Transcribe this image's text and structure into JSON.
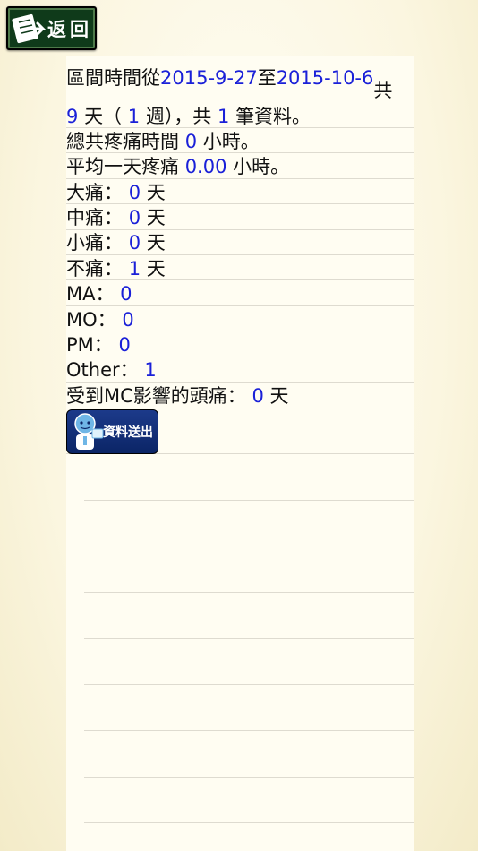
{
  "header": {
    "back_label": "返回"
  },
  "summary": {
    "range_prefix": "區間時間從",
    "start_date": "2015-9-27",
    "to": "至",
    "end_date": "2015-10-6",
    "gong": "共",
    "days": "9",
    "days_suffix": "天（",
    "weeks": "1",
    "weeks_suffix": "週），共",
    "records": "1",
    "records_suffix": "筆資料。",
    "total_label": "總共疼痛時間",
    "total_value": "0",
    "total_unit": "小時。",
    "avg_label": "平均一天疼痛",
    "avg_value": "0.00",
    "avg_unit": "小時。"
  },
  "stats": [
    {
      "label": "大痛：",
      "value": "0",
      "unit": "天"
    },
    {
      "label": "中痛：",
      "value": "0",
      "unit": "天"
    },
    {
      "label": "小痛：",
      "value": "0",
      "unit": "天"
    },
    {
      "label": "不痛：",
      "value": "1",
      "unit": "天"
    },
    {
      "label": "MA：",
      "value": "0",
      "unit": ""
    },
    {
      "label": "MO：",
      "value": "0",
      "unit": ""
    },
    {
      "label": "PM：",
      "value": "0",
      "unit": ""
    },
    {
      "label": "Other：",
      "value": "1",
      "unit": ""
    },
    {
      "label": "受到MC影響的頭痛：",
      "value": "0",
      "unit": "天"
    }
  ],
  "actions": {
    "send_label": "資料送出"
  }
}
